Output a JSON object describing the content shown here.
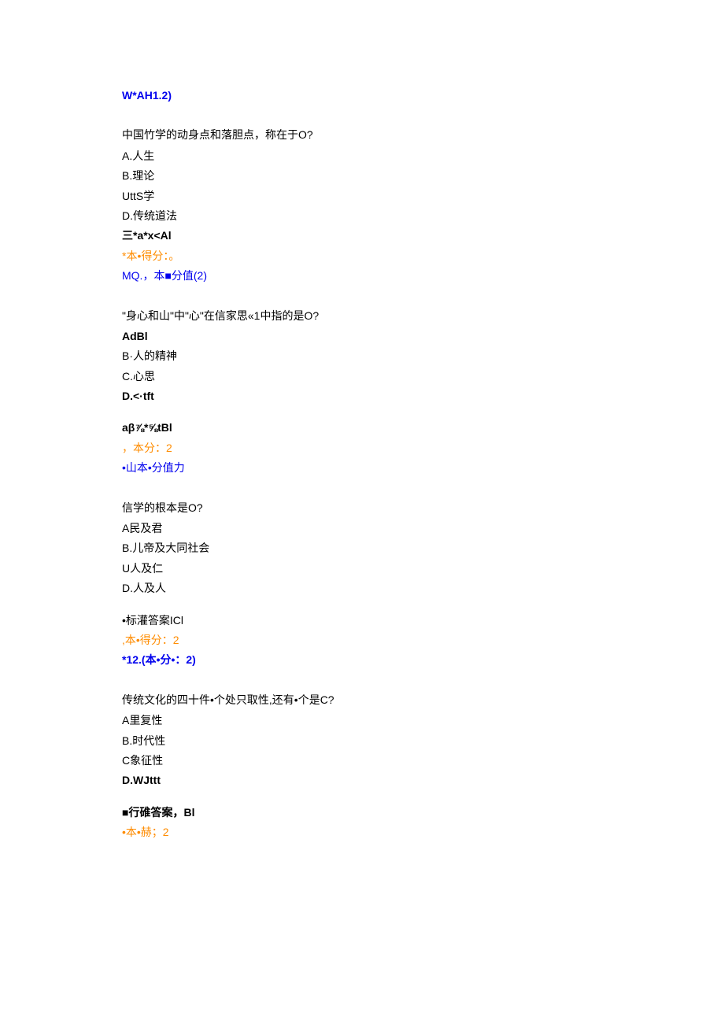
{
  "q9": {
    "header": "W*AH1.2)",
    "question": "中国竹学的动身点和落胆点，称在于O?",
    "options": {
      "a": "A.人生",
      "b": "B.理论",
      "c": "UttS学",
      "d": "D.传统道法",
      "extra": "三*a*x<Al"
    },
    "score": "*本•得分：。",
    "next_header": "MQ.，本■分值(2)"
  },
  "q10": {
    "question": "\"身心和山\"中\"心\"在信家思«1中指的是O?",
    "options": {
      "a": "AdBl",
      "b": "B·人的精神",
      "c": "C.心思",
      "d": "D.<·tft"
    },
    "answer_label": "aβ⅞*⅝tBl",
    "score": "，本分：2",
    "next_header": "•山本•分值力"
  },
  "q11": {
    "question": "信学的根本是O?",
    "options": {
      "a": "A民及君",
      "b": "B.儿帝及大同社会",
      "c": "U人及仁",
      "d": "D.人及人"
    },
    "answer_label": "•标灌答案ICl",
    "score": ",本•得分：2",
    "next_header": "*12.(本•分•：2)"
  },
  "q12": {
    "question": "传统文化的四十件•个处只取性,还有•个是C?",
    "options": {
      "a": "A里复性",
      "b": "B.时代性",
      "c": "C象征性",
      "d": "D.WJttt"
    },
    "answer_label": "■行碓答案，Bl",
    "score": "•本•赫；2"
  }
}
